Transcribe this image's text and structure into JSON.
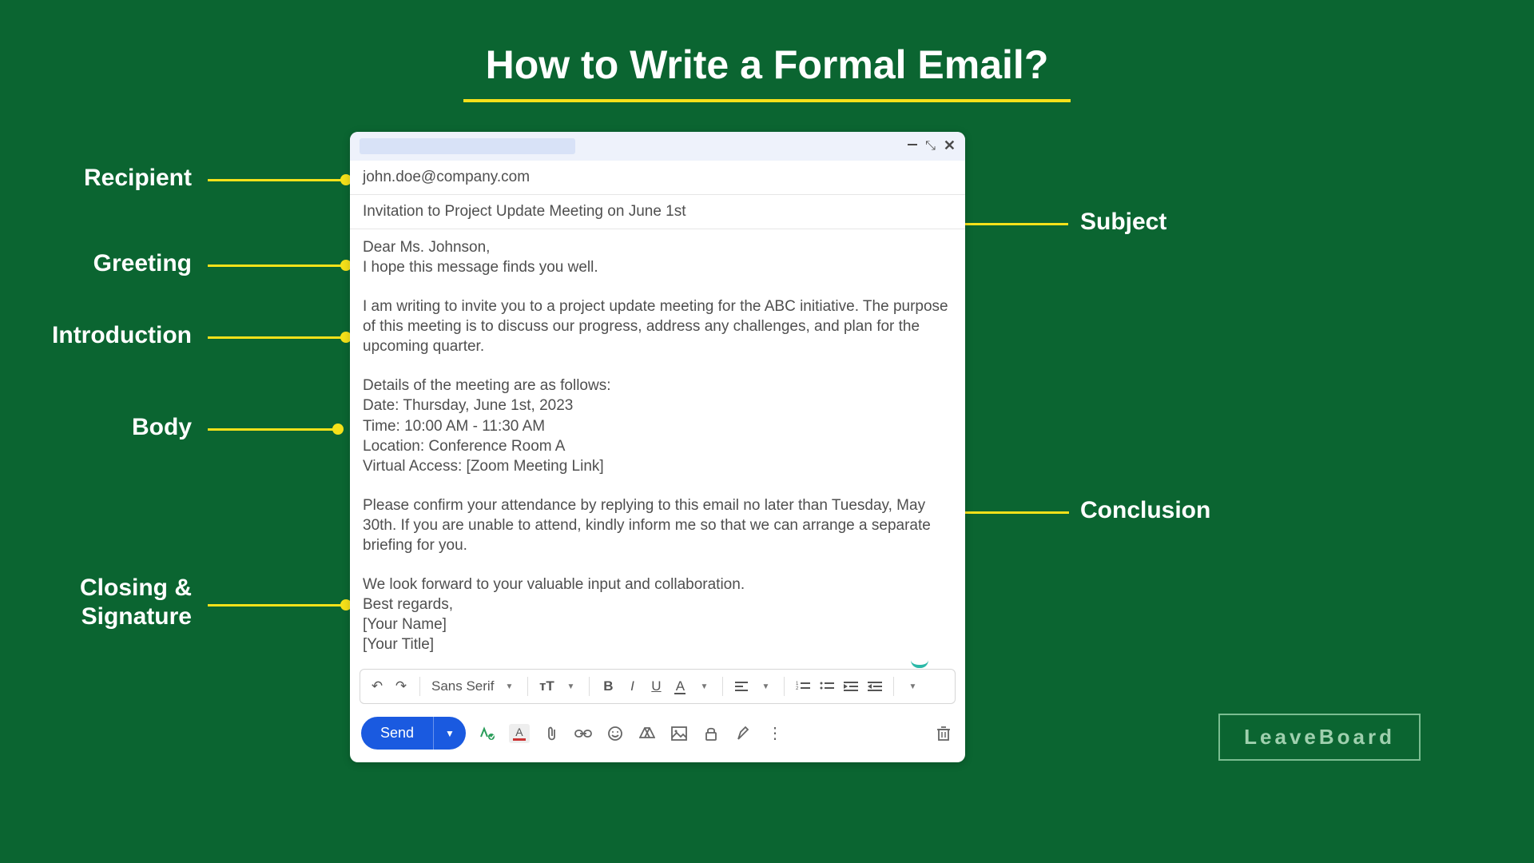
{
  "title": "How to Write a Formal Email?",
  "labels": {
    "recipient": "Recipient",
    "greeting": "Greeting",
    "introduction": "Introduction",
    "body": "Body",
    "closing": "Closing &",
    "signature": "Signature",
    "subject": "Subject",
    "conclusion": "Conclusion"
  },
  "email": {
    "recipient": "john.doe@company.com",
    "subject": "Invitation to Project Update Meeting on June 1st",
    "greeting_line1": "Dear Ms. Johnson,",
    "greeting_line2": "I hope this message finds you well.",
    "intro": "I am writing to invite you to a project update meeting for the ABC initiative. The purpose of this meeting is to discuss our progress, address any challenges, and plan for the upcoming quarter.",
    "details_heading": "Details of the meeting are as follows:",
    "details_date": "Date: Thursday, June 1st, 2023",
    "details_time": "Time: 10:00 AM - 11:30 AM",
    "details_location": "Location: Conference Room A",
    "details_virtual": "Virtual Access: [Zoom Meeting Link]",
    "conclusion": "Please confirm your attendance by replying to this email no later than Tuesday, May 30th. If you are unable to attend, kindly inform me so that we can arrange a separate briefing for you.",
    "closing1": "We look forward to your valuable input and collaboration.",
    "closing2": "Best regards,",
    "closing3": "[Your Name]",
    "closing4": "[Your Title]"
  },
  "toolbar": {
    "font_family": "Sans Serif",
    "send": "Send"
  },
  "brand": "LeaveBoard"
}
